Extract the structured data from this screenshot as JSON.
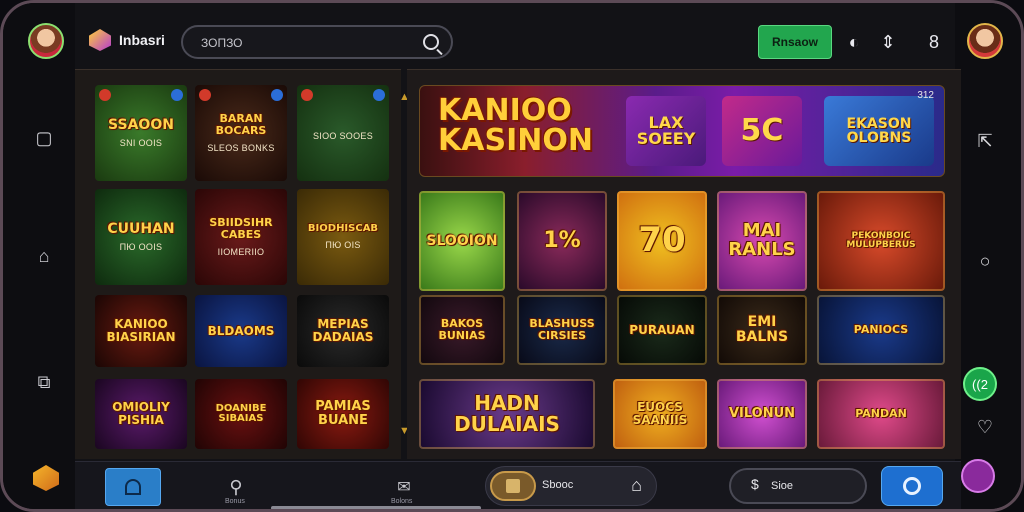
{
  "header": {
    "brand": "Inbasri",
    "search_placeholder": "ЗОПЗО",
    "login_label": "Rnsaow"
  },
  "left_rail": {
    "icons": [
      "square-icon",
      "home-icon",
      "layers-icon"
    ]
  },
  "right_rail": {
    "green_badge": "((2"
  },
  "hero": {
    "title_line1": "KANIOO",
    "title_line2": "KASINON",
    "card1": "LAX SOEEY",
    "card2": "5C",
    "card3": "EKASON OLOBNS",
    "corner": "312"
  },
  "left_tiles": [
    {
      "title": "SSAOON",
      "sub": "SNI OOIS"
    },
    {
      "title": "BARAN BOCARS",
      "sub": "SLEOS BONKS"
    },
    {
      "title": "",
      "sub": "SIOO SOOES"
    },
    {
      "title": "CUUHAN",
      "sub": "ПЮ ООIS"
    },
    {
      "title": "SBIIDSIHR CABES",
      "sub": "IIOMERIIO"
    },
    {
      "title": "BIODHISCAB",
      "sub": "ПЮ OIS"
    },
    {
      "title": "KANIOO BIASIRIAN",
      "sub": ""
    },
    {
      "title": "BLDAOMS",
      "sub": ""
    },
    {
      "title": "MEPIAS DADAIAS",
      "sub": ""
    },
    {
      "title": "OMIOLIY PISHIA",
      "sub": ""
    },
    {
      "title": "DOANIBE SIBAIAS",
      "sub": ""
    },
    {
      "title": "PAMIAS BUANE",
      "sub": ""
    }
  ],
  "right_tiles": [
    {
      "title": "SLOOION"
    },
    {
      "title": "1%"
    },
    {
      "title": "70"
    },
    {
      "title": "MAI RANLS"
    },
    {
      "title": "PEKONBOIC MULUPBERUS"
    },
    {
      "title": "BAKOS BUNIAS"
    },
    {
      "title": "BLASHUSS CIRSIES"
    },
    {
      "title": "PURAUAN"
    },
    {
      "title": "EMI BALNS"
    },
    {
      "title": "PANIOCS"
    },
    {
      "title": "HADN DULAIAIS"
    },
    {
      "title": "EUOCS SAANIIS"
    },
    {
      "title": "VILONUN"
    },
    {
      "title": "PANDAN"
    }
  ],
  "bottom": {
    "nav2_label": "Bonus",
    "nav3_label": "Bolons",
    "pill_text": "Sbooc",
    "pill2_icon": "$",
    "pill2_text": "Sioe"
  },
  "colors": {
    "accent_green": "#22a64e",
    "accent_blue": "#1e6fd0",
    "gold": "#ffd34a"
  }
}
